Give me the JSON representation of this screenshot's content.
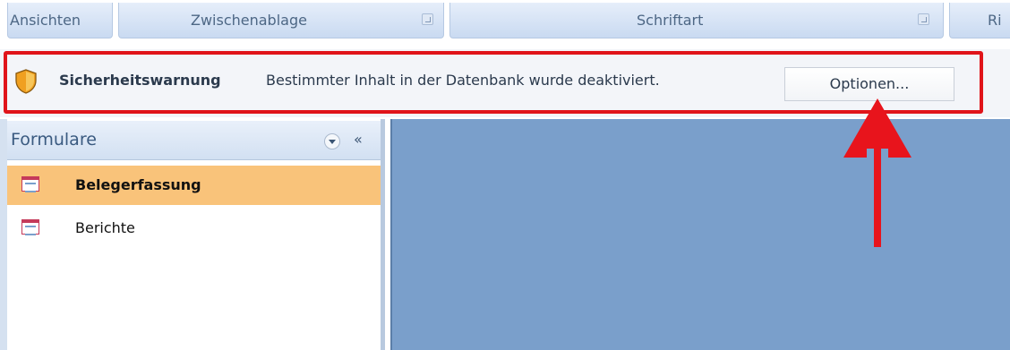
{
  "ribbon": {
    "groups": [
      "Ansichten",
      "Zwischenablage",
      "Schriftart",
      "Ri"
    ]
  },
  "message_bar": {
    "title": "Sicherheitswarnung",
    "message": "Bestimmter Inhalt in der Datenbank wurde deaktiviert.",
    "button_label": "Optionen...",
    "icon": "shield-icon"
  },
  "nav_pane": {
    "title": "Formulare",
    "collapse_glyph": "«",
    "items": [
      {
        "label": "Belegerfassung",
        "selected": true,
        "icon": "form-icon"
      },
      {
        "label": "Berichte",
        "selected": false,
        "icon": "form-icon"
      }
    ]
  },
  "colors": {
    "highlight": "#e0141a",
    "selected_item": "#f9c37a",
    "workspace": "#7a9fcb"
  }
}
